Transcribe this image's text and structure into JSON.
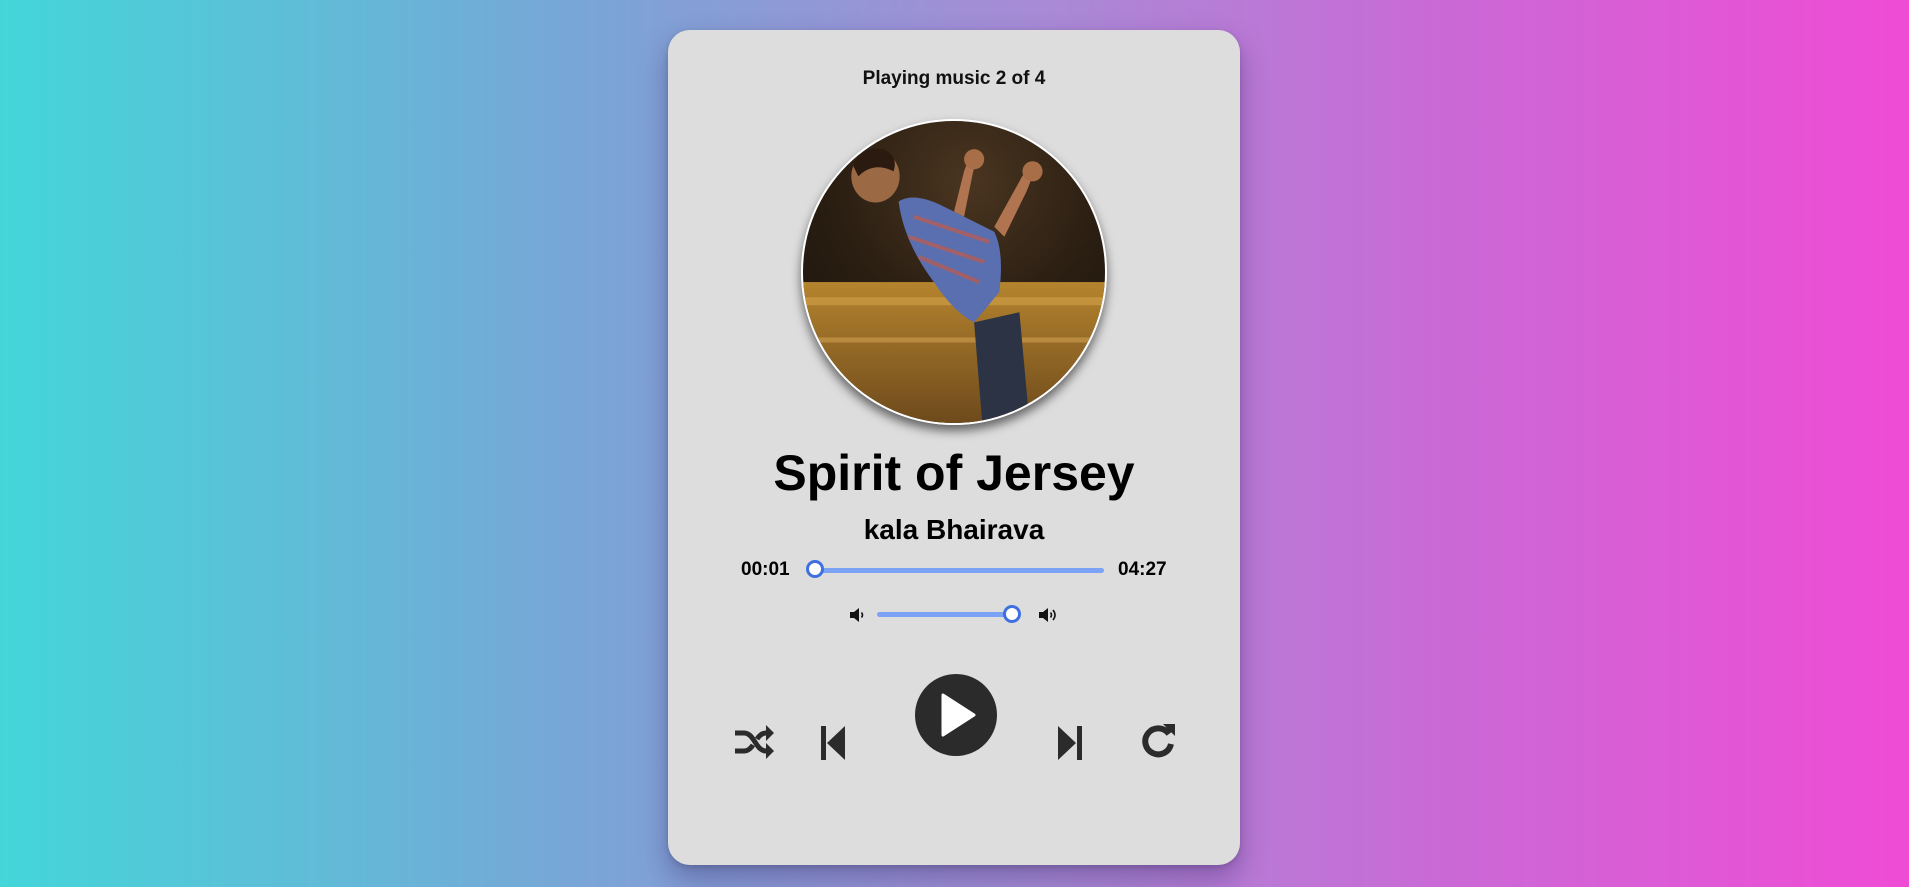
{
  "player": {
    "status_text": "Playing music 2 of 4",
    "track_index": 2,
    "track_count": 4,
    "song_title": "Spirit of Jersey",
    "artist": "kala Bhairava",
    "current_time": "00:01",
    "total_time": "04:27",
    "progress_fraction": 0.004,
    "volume_fraction": 1.0,
    "cover_art_icon": "album-cover-image"
  },
  "controls": {
    "shuffle": "shuffle-icon",
    "previous": "skip-previous-icon",
    "play": "play-icon",
    "next": "skip-next-icon",
    "repeat": "repeat-icon"
  },
  "colors": {
    "card_background": "#dddddd",
    "slider_track": "#7ba2f5",
    "slider_thumb_border": "#3f6fe0",
    "control_color": "#2b2b2b",
    "gradient_left": "#43d6d9",
    "gradient_right": "#f04bd5"
  }
}
